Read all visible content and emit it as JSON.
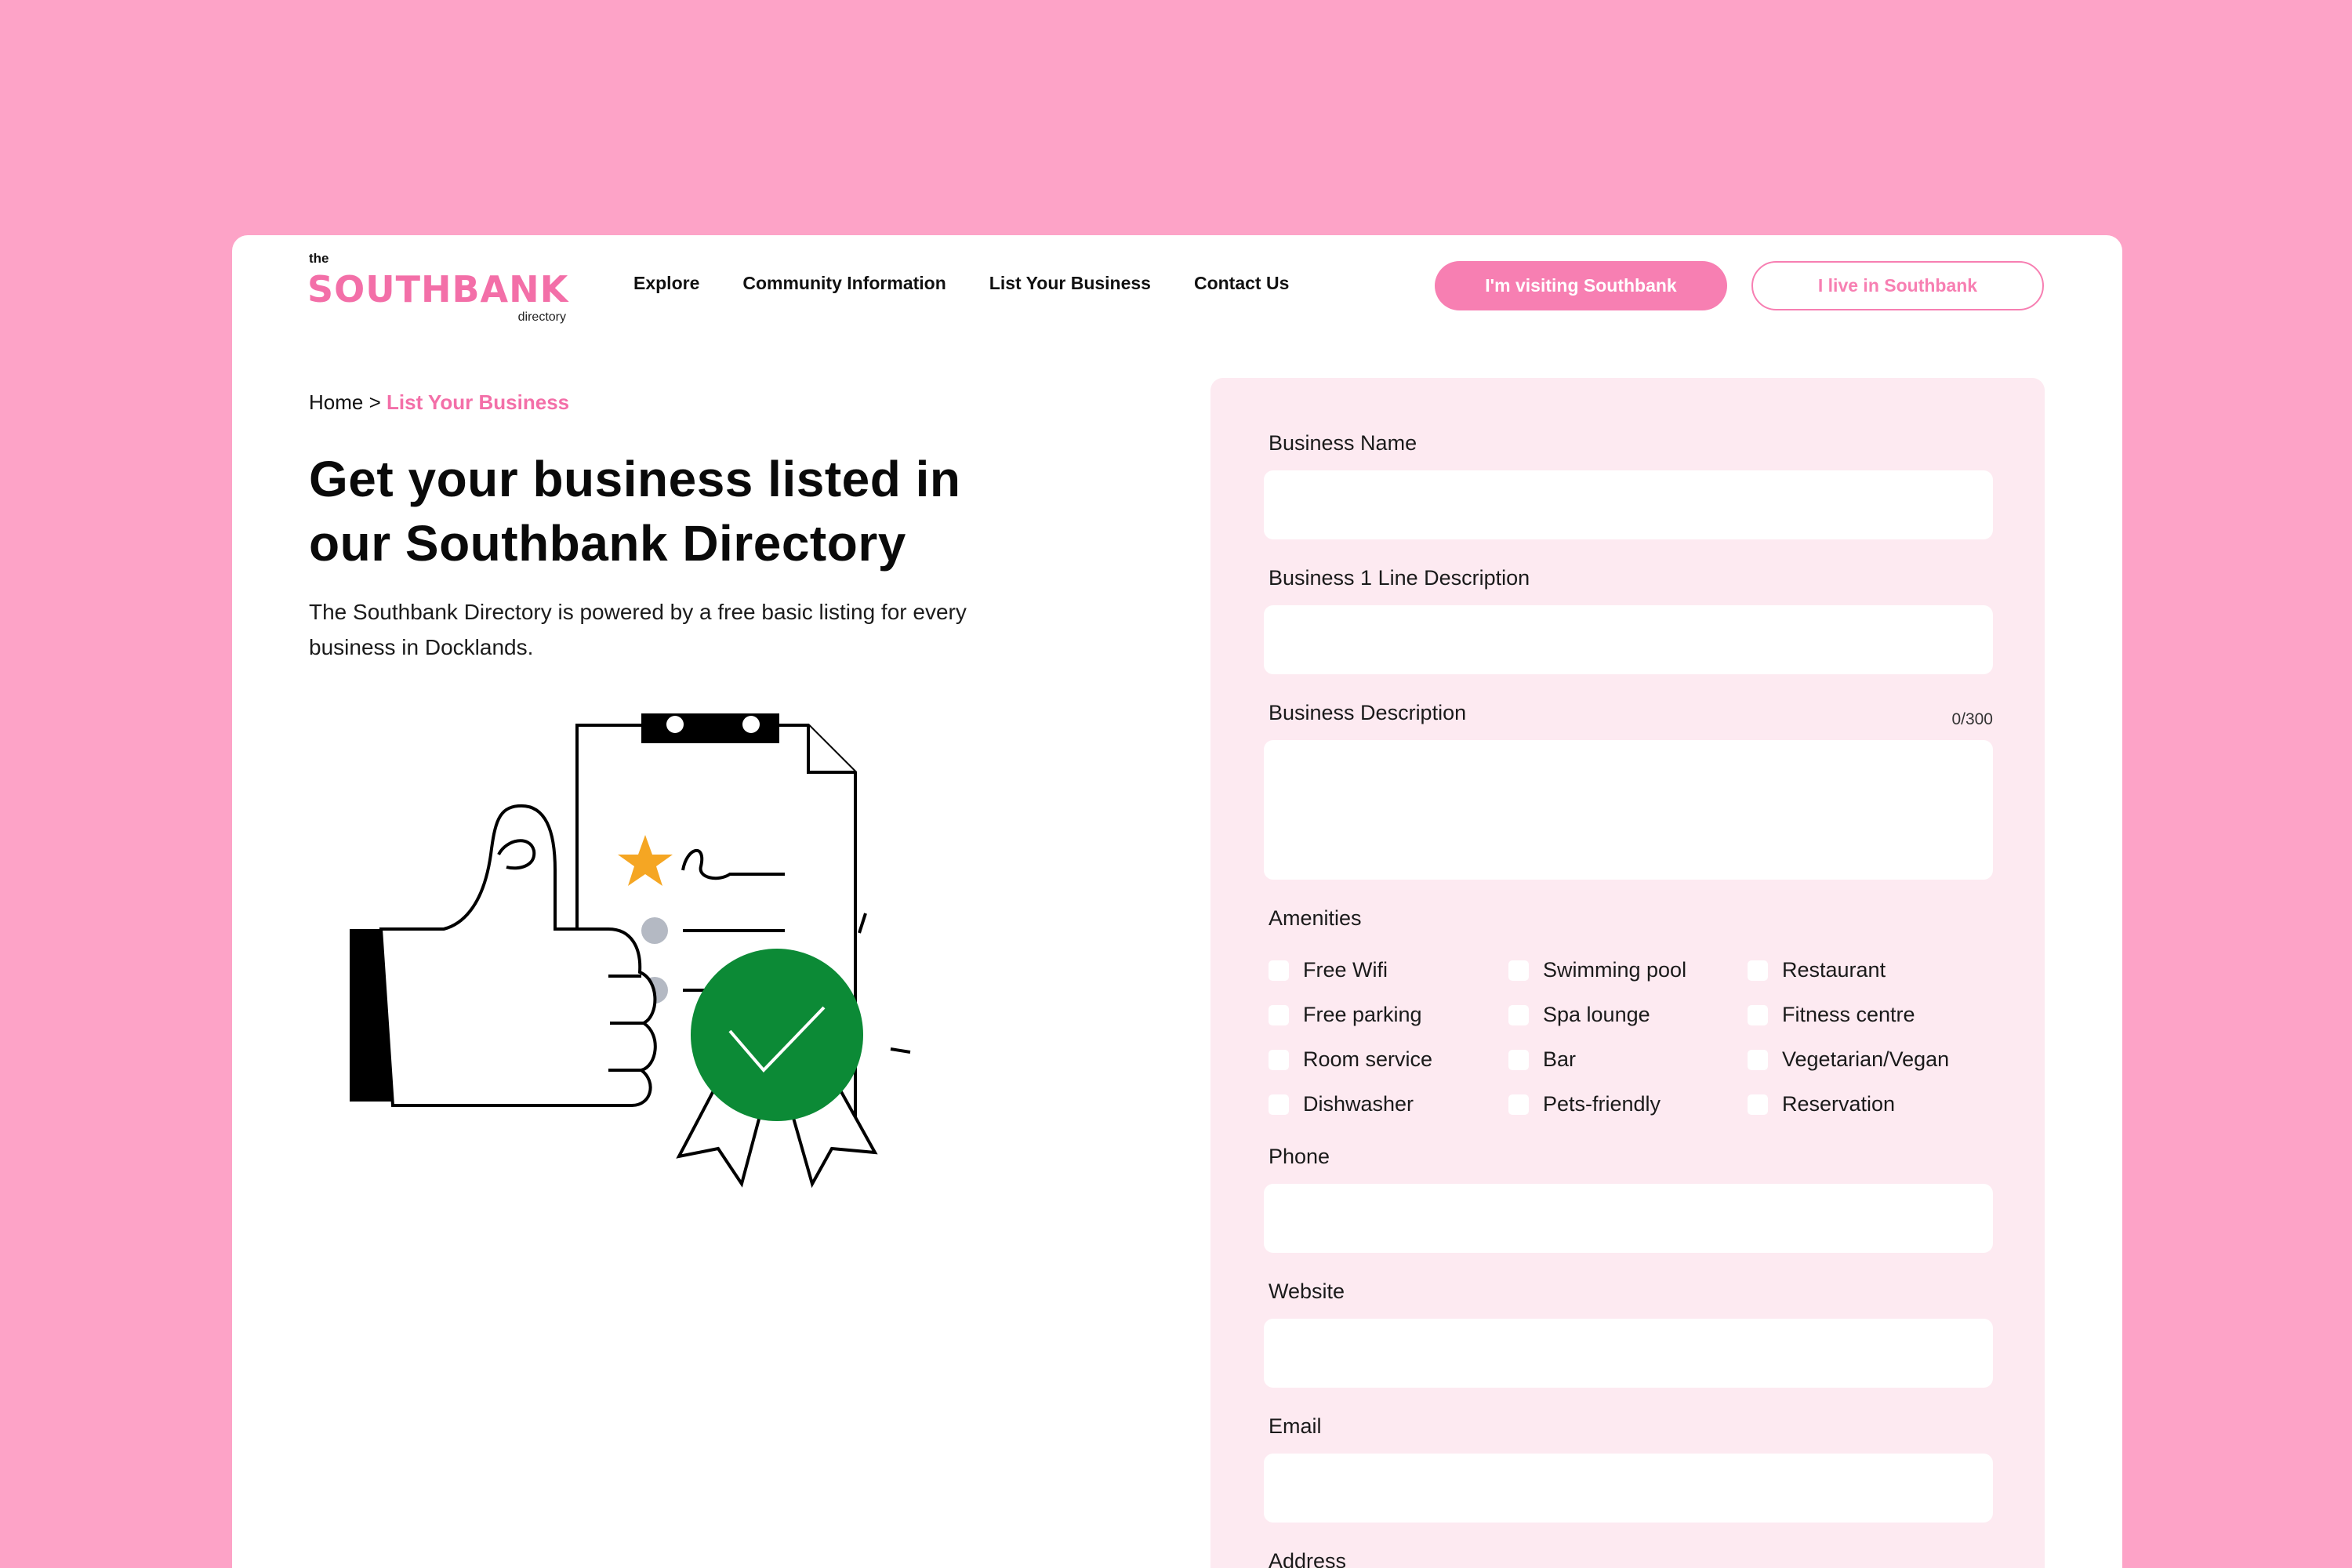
{
  "colors": {
    "page_bg": "#fda3c7",
    "accent": "#f36fa8",
    "panel_bg": "#fdeaf1",
    "badge_green": "#0c8a36",
    "star": "#f5a623"
  },
  "logo": {
    "top": "the",
    "main": "SOUTHBANK",
    "sub": "directory"
  },
  "nav": [
    "Explore",
    "Community Information",
    "List Your Business",
    "Contact Us"
  ],
  "header_buttons": {
    "visiting": "I'm visiting Southbank",
    "live": "I live in Southbank"
  },
  "breadcrumb": {
    "home": "Home",
    "sep": ">",
    "current": "List Your Business"
  },
  "hero": {
    "title": "Get your business listed in our Southbank Directory",
    "intro": "The Southbank Directory is powered by a free basic listing for every business in Docklands."
  },
  "form": {
    "business_name": "Business Name",
    "one_line": "Business 1 Line Description",
    "description": "Business Description",
    "counter": "0/300",
    "amenities_label": "Amenities",
    "amenities": [
      "Free Wifi",
      "Swimming pool",
      "Restaurant",
      "Free parking",
      "Spa lounge",
      "Fitness centre",
      "Room service",
      "Bar",
      "Vegetarian/Vegan",
      "Dishwasher",
      "Pets-friendly",
      "Reservation"
    ],
    "phone": "Phone",
    "website": "Website",
    "email": "Email",
    "address": "Address"
  },
  "icons": {
    "logo_pin": "location-pin-icon",
    "illustration": "thumbs-up-checklist-illustration"
  }
}
